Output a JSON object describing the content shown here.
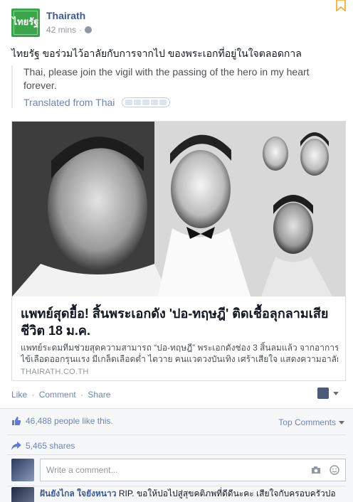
{
  "post": {
    "page_name": "Thairath",
    "logo_text": "ไทยรัฐ",
    "timestamp": "42 mins",
    "meta_separator": "·",
    "privacy_icon": "globe-icon",
    "text": "ไทยรัฐ ขอร่วมไว้อาลัยกับการจากไป ของพระเอกที่อยู่ในใจตลอดกาล",
    "translation": {
      "text": "Thai, please join the vigil with the passing of the hero in my heart forever.",
      "source_label": "Translated from Thai"
    }
  },
  "link": {
    "title": "แพทย์สุดยื้อ! สิ้นพระเอกดัง 'ปอ-ทฤษฎี' ติดเชื้อลุกลามเสียชีวิต 18 ม.ค.",
    "description_line1": "แพทย์ระดมทีมช่วยสุดความสามารถ “ปอ-ทฤษฎี” พระเอกดังช่อง 3 สิ้นลมแล้ว จากอาการป่วย",
    "description_line2": "ไข้เลือดออกรุนแรง มีเกล็ดเลือดต่ำ ไตวาย คนแวดวงบันเทิง เศร้าเสียใจ แสดงความอาลัย...",
    "domain": "THAIRATH.CO.TH"
  },
  "actions": {
    "like": "Like",
    "comment": "Comment",
    "share": "Share",
    "sep": "·"
  },
  "ufi": {
    "likes": "46,488 people like this.",
    "top_comments": "Top Comments",
    "shares": "5,465 shares",
    "comment_placeholder": "Write a comment..."
  },
  "comment": {
    "author": "ฝันยังไกล ใจยังหนาว",
    "text": "RIP. ขอให้ปอไปสู่สุขคติภพที่ดีดีนะคะ เสียใจกับครอบครัวปอ"
  },
  "colors": {
    "link": "#3b5998",
    "accent": "#6d84b4",
    "logo_green": "#3aa54a",
    "bookmark": "#f7a51c"
  }
}
